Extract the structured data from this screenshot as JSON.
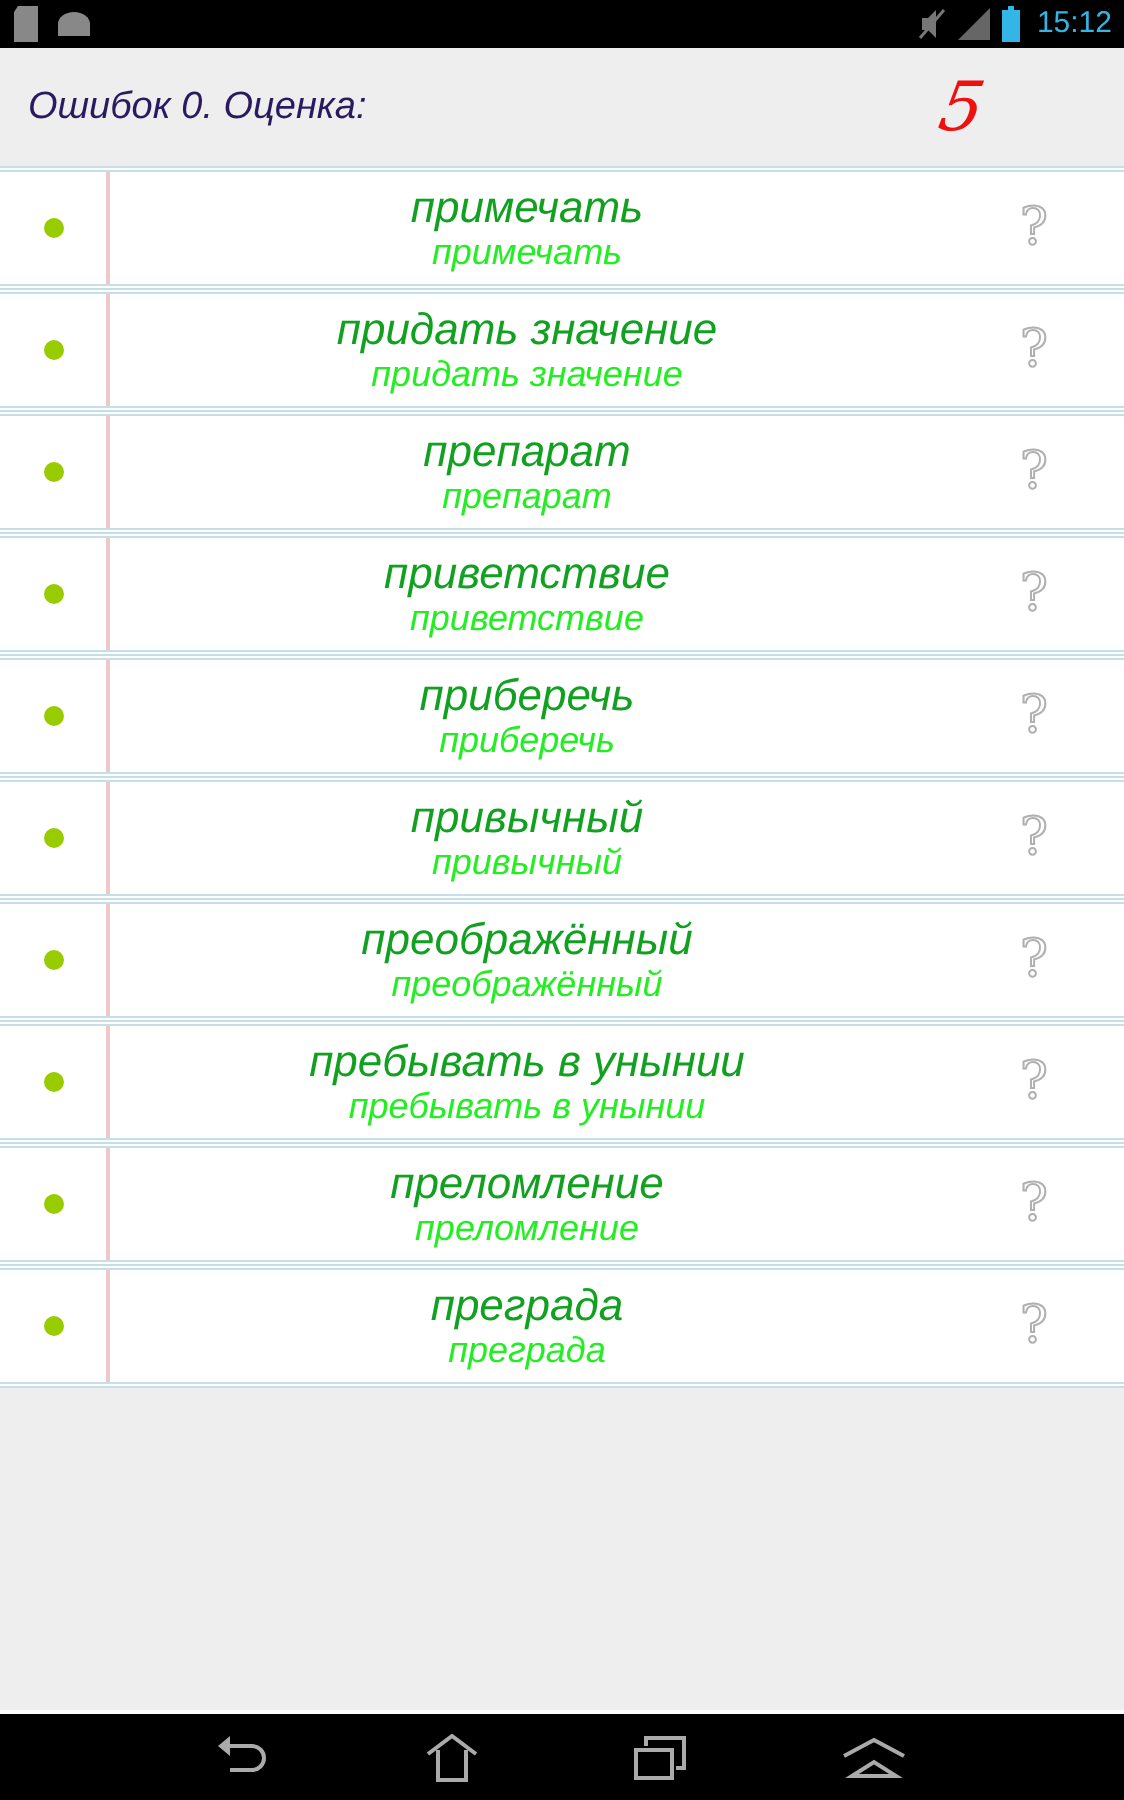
{
  "status_bar": {
    "time": "15:12"
  },
  "header": {
    "summary": "Ошибок 0. Оценка:",
    "grade": "5"
  },
  "words": [
    {
      "word": "примечать",
      "answer": "примечать",
      "hint": "?"
    },
    {
      "word": "придать значение",
      "answer": "придать значение",
      "hint": "?"
    },
    {
      "word": "препарат",
      "answer": "препарат",
      "hint": "?"
    },
    {
      "word": "приветствие",
      "answer": "приветствие",
      "hint": "?"
    },
    {
      "word": "приберечь",
      "answer": "приберечь",
      "hint": "?"
    },
    {
      "word": "привычный",
      "answer": "привычный",
      "hint": "?"
    },
    {
      "word": "преображённый",
      "answer": "преображённый",
      "hint": "?"
    },
    {
      "word": "пребывать в унынии",
      "answer": "пребывать в унынии",
      "hint": "?"
    },
    {
      "word": "преломление",
      "answer": "преломление",
      "hint": "?"
    },
    {
      "word": "преграда",
      "answer": "преграда",
      "hint": "?"
    }
  ]
}
